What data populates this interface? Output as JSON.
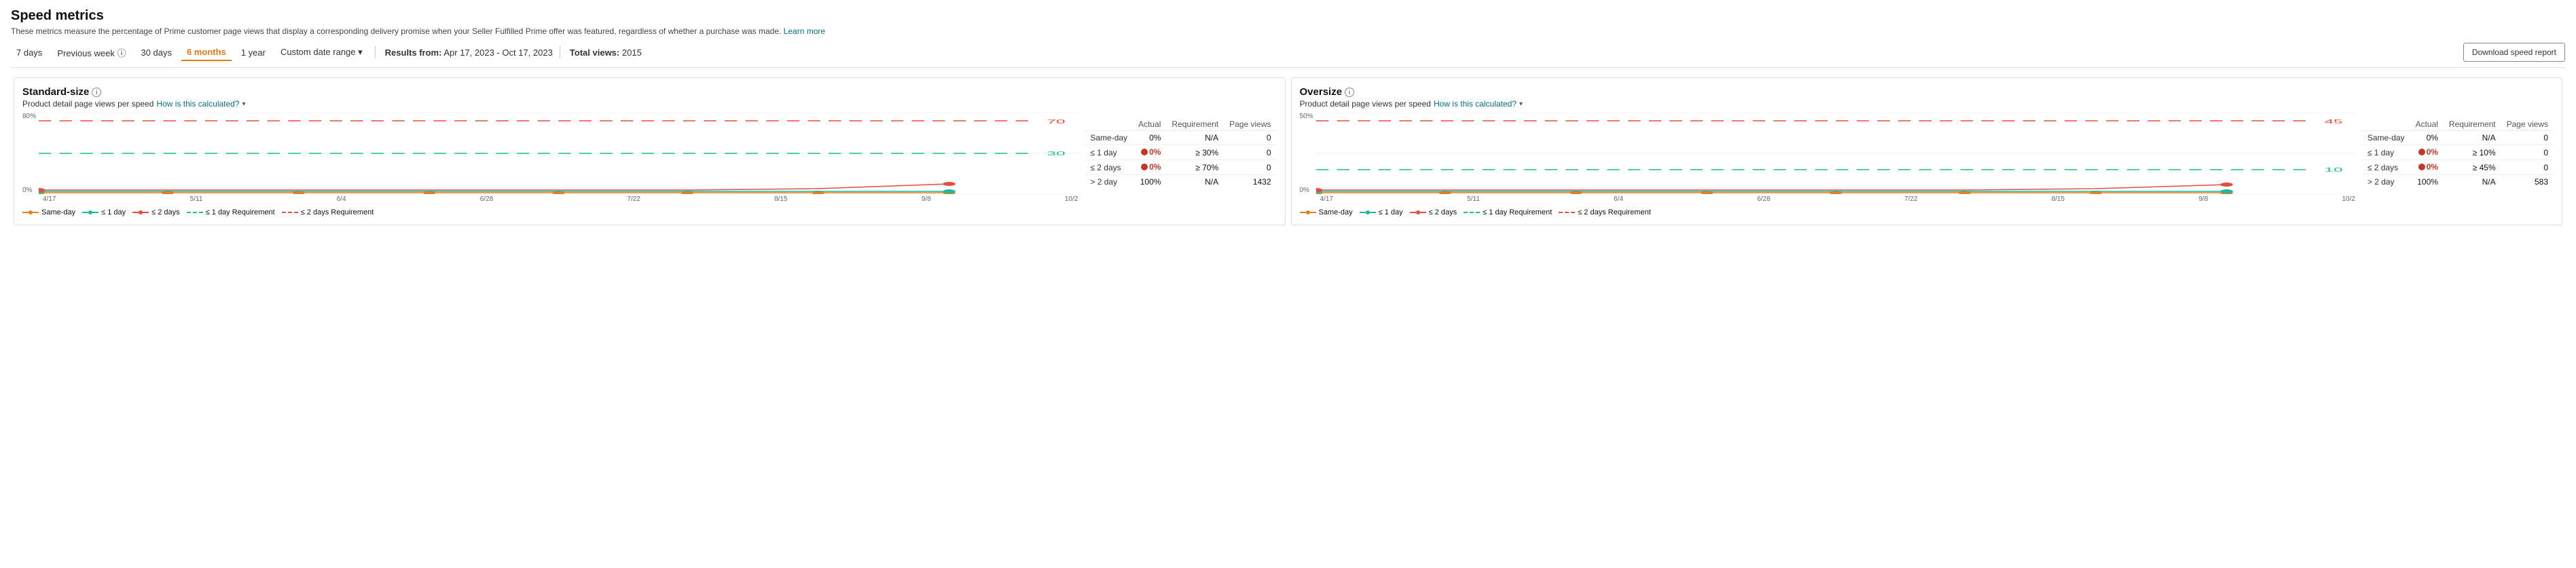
{
  "page": {
    "title": "Speed metrics",
    "subtitle": "These metrics measure the percentage of Prime customer page views that display a corresponding delivery promise when your Seller Fulfilled Prime offer was featured, regardless of whether a purchase was made.",
    "subtitle_link": "Learn more"
  },
  "toolbar": {
    "filters": [
      "7 days",
      "Previous week",
      "30 days",
      "6 months",
      "1 year",
      "Custom date range"
    ],
    "active_filter": "6 months",
    "results_label": "Results from:",
    "results_range": "Apr 17, 2023 - Oct 17, 2023",
    "total_views_label": "Total views:",
    "total_views": "2015",
    "download_btn": "Download speed report"
  },
  "panels": [
    {
      "id": "standard",
      "title": "Standard-size",
      "chart_subtitle": "Product detail page views per speed",
      "how_calculated": "How is this calculated?",
      "y_labels": [
        "80%",
        "0%"
      ],
      "x_labels": [
        "4/17",
        "5/11",
        "6/4",
        "6/28",
        "7/22",
        "8/15",
        "9/8",
        "10/2"
      ],
      "ref_lines": [
        {
          "label": "70",
          "color": "#e74c3c",
          "pct": 10,
          "dashed": true
        },
        {
          "label": "30",
          "color": "#1abc9c",
          "pct": 50,
          "dashed": true
        }
      ],
      "legend": [
        {
          "label": "Same-day",
          "color": "#e67e22",
          "dashed": false
        },
        {
          "label": "≤ 1 day",
          "color": "#1abc9c",
          "dashed": false
        },
        {
          "label": "≤ 2 days",
          "color": "#e74c3c",
          "dashed": false
        },
        {
          "label": "≤ 1 day Requirement",
          "color": "#1abc9c",
          "dashed": true
        },
        {
          "label": "≤ 2 days Requirement",
          "color": "#e74c3c",
          "dashed": true
        }
      ],
      "table": {
        "headers": [
          "",
          "Actual",
          "Requirement",
          "Page views"
        ],
        "rows": [
          {
            "label": "Same-day",
            "actual": "0%",
            "requirement": "N/A",
            "page_views": "0",
            "error": false
          },
          {
            "label": "≤ 1 day",
            "actual": "0%",
            "requirement": "≥ 30%",
            "page_views": "0",
            "error": true
          },
          {
            "label": "≤ 2 days",
            "actual": "0%",
            "requirement": "≥ 70%",
            "page_views": "0",
            "error": true
          },
          {
            "label": "> 2 day",
            "actual": "100%",
            "requirement": "N/A",
            "page_views": "1432",
            "error": false
          }
        ]
      }
    },
    {
      "id": "oversize",
      "title": "Oversize",
      "chart_subtitle": "Product detail page views per speed",
      "how_calculated": "How is this calculated?",
      "y_labels": [
        "50%",
        "0%"
      ],
      "x_labels": [
        "4/17",
        "5/11",
        "6/4",
        "6/28",
        "7/22",
        "8/15",
        "9/8",
        "10/2"
      ],
      "ref_lines": [
        {
          "label": "45",
          "color": "#e74c3c",
          "pct": 10,
          "dashed": true
        },
        {
          "label": "10",
          "color": "#1abc9c",
          "pct": 70,
          "dashed": true
        }
      ],
      "legend": [
        {
          "label": "Same-day",
          "color": "#e67e22",
          "dashed": false
        },
        {
          "label": "≤ 1 day",
          "color": "#1abc9c",
          "dashed": false
        },
        {
          "label": "≤ 2 days",
          "color": "#e74c3c",
          "dashed": false
        },
        {
          "label": "≤ 1 day Requirement",
          "color": "#1abc9c",
          "dashed": true
        },
        {
          "label": "≤ 2 days Requirement",
          "color": "#e74c3c",
          "dashed": true
        }
      ],
      "table": {
        "headers": [
          "",
          "Actual",
          "Requirement",
          "Page views"
        ],
        "rows": [
          {
            "label": "Same-day",
            "actual": "0%",
            "requirement": "N/A",
            "page_views": "0",
            "error": false
          },
          {
            "label": "≤ 1 day",
            "actual": "0%",
            "requirement": "≥ 10%",
            "page_views": "0",
            "error": true
          },
          {
            "label": "≤ 2 days",
            "actual": "0%",
            "requirement": "≥ 45%",
            "page_views": "0",
            "error": true
          },
          {
            "label": "> 2 day",
            "actual": "100%",
            "requirement": "N/A",
            "page_views": "583",
            "error": false
          }
        ]
      }
    }
  ]
}
